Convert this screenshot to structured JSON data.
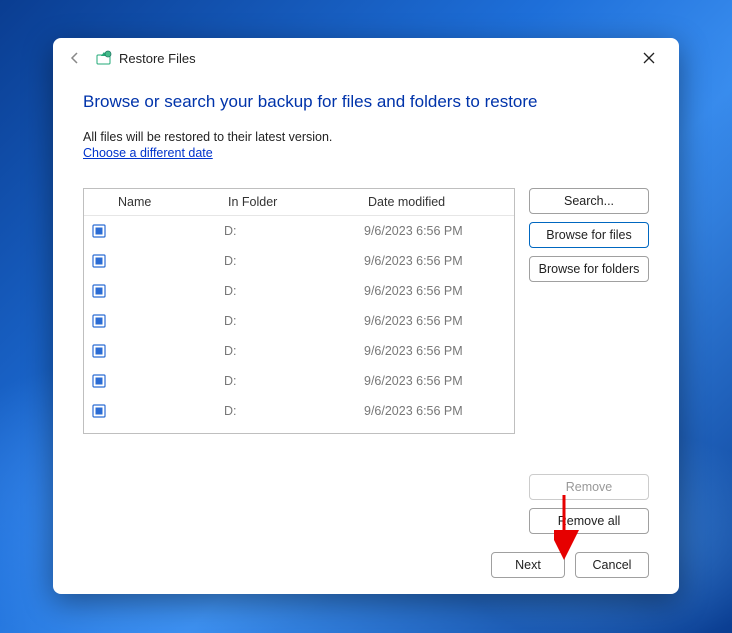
{
  "window": {
    "title": "Restore Files",
    "heading": "Browse or search your backup for files and folders to restore",
    "subtext": "All files will be restored to their latest version.",
    "date_link": "Choose a different date"
  },
  "columns": {
    "name": "Name",
    "folder": "In Folder",
    "date": "Date modified"
  },
  "rows": [
    {
      "name": "",
      "folder": "D:",
      "date": "9/6/2023 6:56 PM"
    },
    {
      "name": "",
      "folder": "D:",
      "date": "9/6/2023 6:56 PM"
    },
    {
      "name": "",
      "folder": "D:",
      "date": "9/6/2023 6:56 PM"
    },
    {
      "name": "",
      "folder": "D:",
      "date": "9/6/2023 6:56 PM"
    },
    {
      "name": "",
      "folder": "D:",
      "date": "9/6/2023 6:56 PM"
    },
    {
      "name": "",
      "folder": "D:",
      "date": "9/6/2023 6:56 PM"
    },
    {
      "name": "",
      "folder": "D:",
      "date": "9/6/2023 6:56 PM"
    }
  ],
  "buttons": {
    "search": "Search...",
    "browse_files": "Browse for files",
    "browse_folders": "Browse for folders",
    "remove": "Remove",
    "remove_all": "Remove all",
    "next": "Next",
    "cancel": "Cancel"
  }
}
